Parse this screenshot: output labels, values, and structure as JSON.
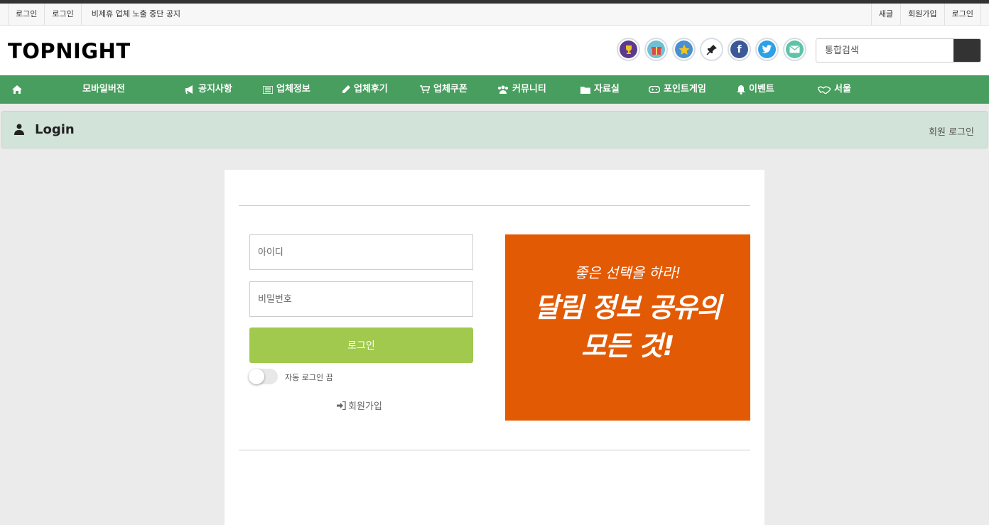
{
  "utility_bar": {
    "left_items": [
      "로그인",
      "로그인",
      "비제휴 업체 노출 중단 공지"
    ],
    "right_items": [
      "새글",
      "회원가입",
      "로그인"
    ]
  },
  "header": {
    "logo": "TOPNIGHT",
    "icons": [
      {
        "name": "trophy-icon",
        "color": "#5b3a8e"
      },
      {
        "name": "gift-icon",
        "color": "#6ec0d4"
      },
      {
        "name": "star-icon",
        "color": "#4a8fd0"
      },
      {
        "name": "pin-icon",
        "color": "#ffffff"
      },
      {
        "name": "facebook-icon",
        "color": "#3b5998"
      },
      {
        "name": "twitter-icon",
        "color": "#2ea1e6"
      },
      {
        "name": "mail-icon",
        "color": "#5ec3a8"
      }
    ],
    "search_placeholder": "통합검색"
  },
  "nav": {
    "color": "#489e5e",
    "items": [
      {
        "label": "",
        "icon": "home-icon"
      },
      {
        "label": "모바일버전",
        "icon": ""
      },
      {
        "label": "공지사항",
        "icon": "bullhorn-icon"
      },
      {
        "label": "업체정보",
        "icon": "list-icon"
      },
      {
        "label": "업체후기",
        "icon": "pencil-icon"
      },
      {
        "label": "업체쿠폰",
        "icon": "cart-icon"
      },
      {
        "label": "커뮤니티",
        "icon": "users-icon"
      },
      {
        "label": "자료실",
        "icon": "folder-icon"
      },
      {
        "label": "포인트게임",
        "icon": "gamepad-icon"
      },
      {
        "label": "이벤트",
        "icon": "bell-icon"
      },
      {
        "label": "서울",
        "icon": "handshake-icon"
      }
    ]
  },
  "title_bar": {
    "title": "Login",
    "breadcrumb": "회원 로그인"
  },
  "login": {
    "id_placeholder": "아이디",
    "password_placeholder": "비밀번호",
    "login_button": "로그인",
    "auto_login_label": "자동 로그인 끔",
    "auto_login_on": false,
    "join_link": "회원가입",
    "accent": "#a0c94e"
  },
  "banner": {
    "subtitle": "좋은 선택을 하라!",
    "line1": "달림 정보 공유의",
    "line2": "모든 것!",
    "color": "#e35a05"
  }
}
